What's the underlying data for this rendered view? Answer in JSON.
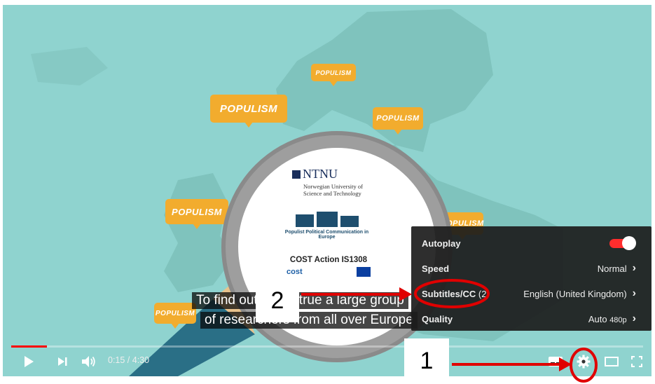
{
  "video": {
    "bubble_text": "POPULISM",
    "logo": {
      "ntnu_name": "NTNU",
      "ntnu_subtitle_line1": "Norwegian University of",
      "ntnu_subtitle_line2": "Science and Technology",
      "project_name": "Populist Political Communication in Europe",
      "cost_action": "COST Action IS1308",
      "cost_word": "cost"
    },
    "subtitles": {
      "line1": "To find out this is true a large group",
      "line2": "of researchers from all over Europe"
    }
  },
  "player": {
    "current_time": "0:15",
    "duration": "4:30",
    "time_display": "0:15 / 4:30",
    "progress_fraction": 0.056,
    "accent_color": "#ff0000"
  },
  "settings_menu": {
    "autoplay_label": "Autoplay",
    "autoplay_on": true,
    "speed_label": "Speed",
    "speed_value": "Normal",
    "subtitles_label": "Subtitles/CC",
    "subtitles_count": "(2)",
    "subtitles_value": "English (United Kingdom)",
    "quality_label": "Quality",
    "quality_value": "Auto",
    "quality_detail": "480p"
  },
  "annotations": {
    "step1": "1",
    "step2": "2",
    "annotation_color": "#e00000"
  },
  "icons": [
    "play-icon",
    "next-icon",
    "volume-icon",
    "subtitles-icon",
    "settings-gear-icon",
    "theater-mode-icon",
    "fullscreen-icon"
  ]
}
